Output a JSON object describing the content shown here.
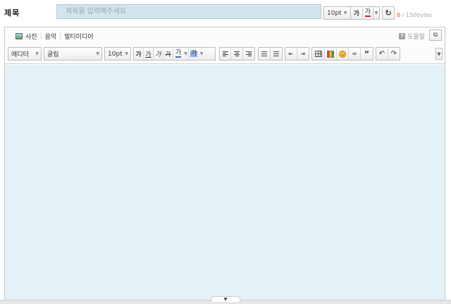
{
  "title": {
    "label": "제목",
    "placeholder": "제목을 입력해주세요",
    "font_size": "10pt",
    "bold_label": "가",
    "color_label": "가",
    "refresh_icon": "refresh-icon",
    "byte_count": "0",
    "byte_limit": "/ 150bytes"
  },
  "attach": {
    "photo": "사진",
    "music": "음악",
    "multimedia": "멀티미디어",
    "help": "도움말"
  },
  "toolbar": {
    "style_select": "에디터",
    "font_select": "굴림",
    "size_select": "10pt",
    "bold": "가",
    "underline": "가",
    "italic": "가",
    "strike": "가",
    "font_color": "가",
    "bg_color": "가",
    "quote": "“"
  },
  "colors": {
    "title_input_bg": "#d3e4ec",
    "content_bg": "#e4f1f6",
    "byte_count": "#e8380d"
  }
}
